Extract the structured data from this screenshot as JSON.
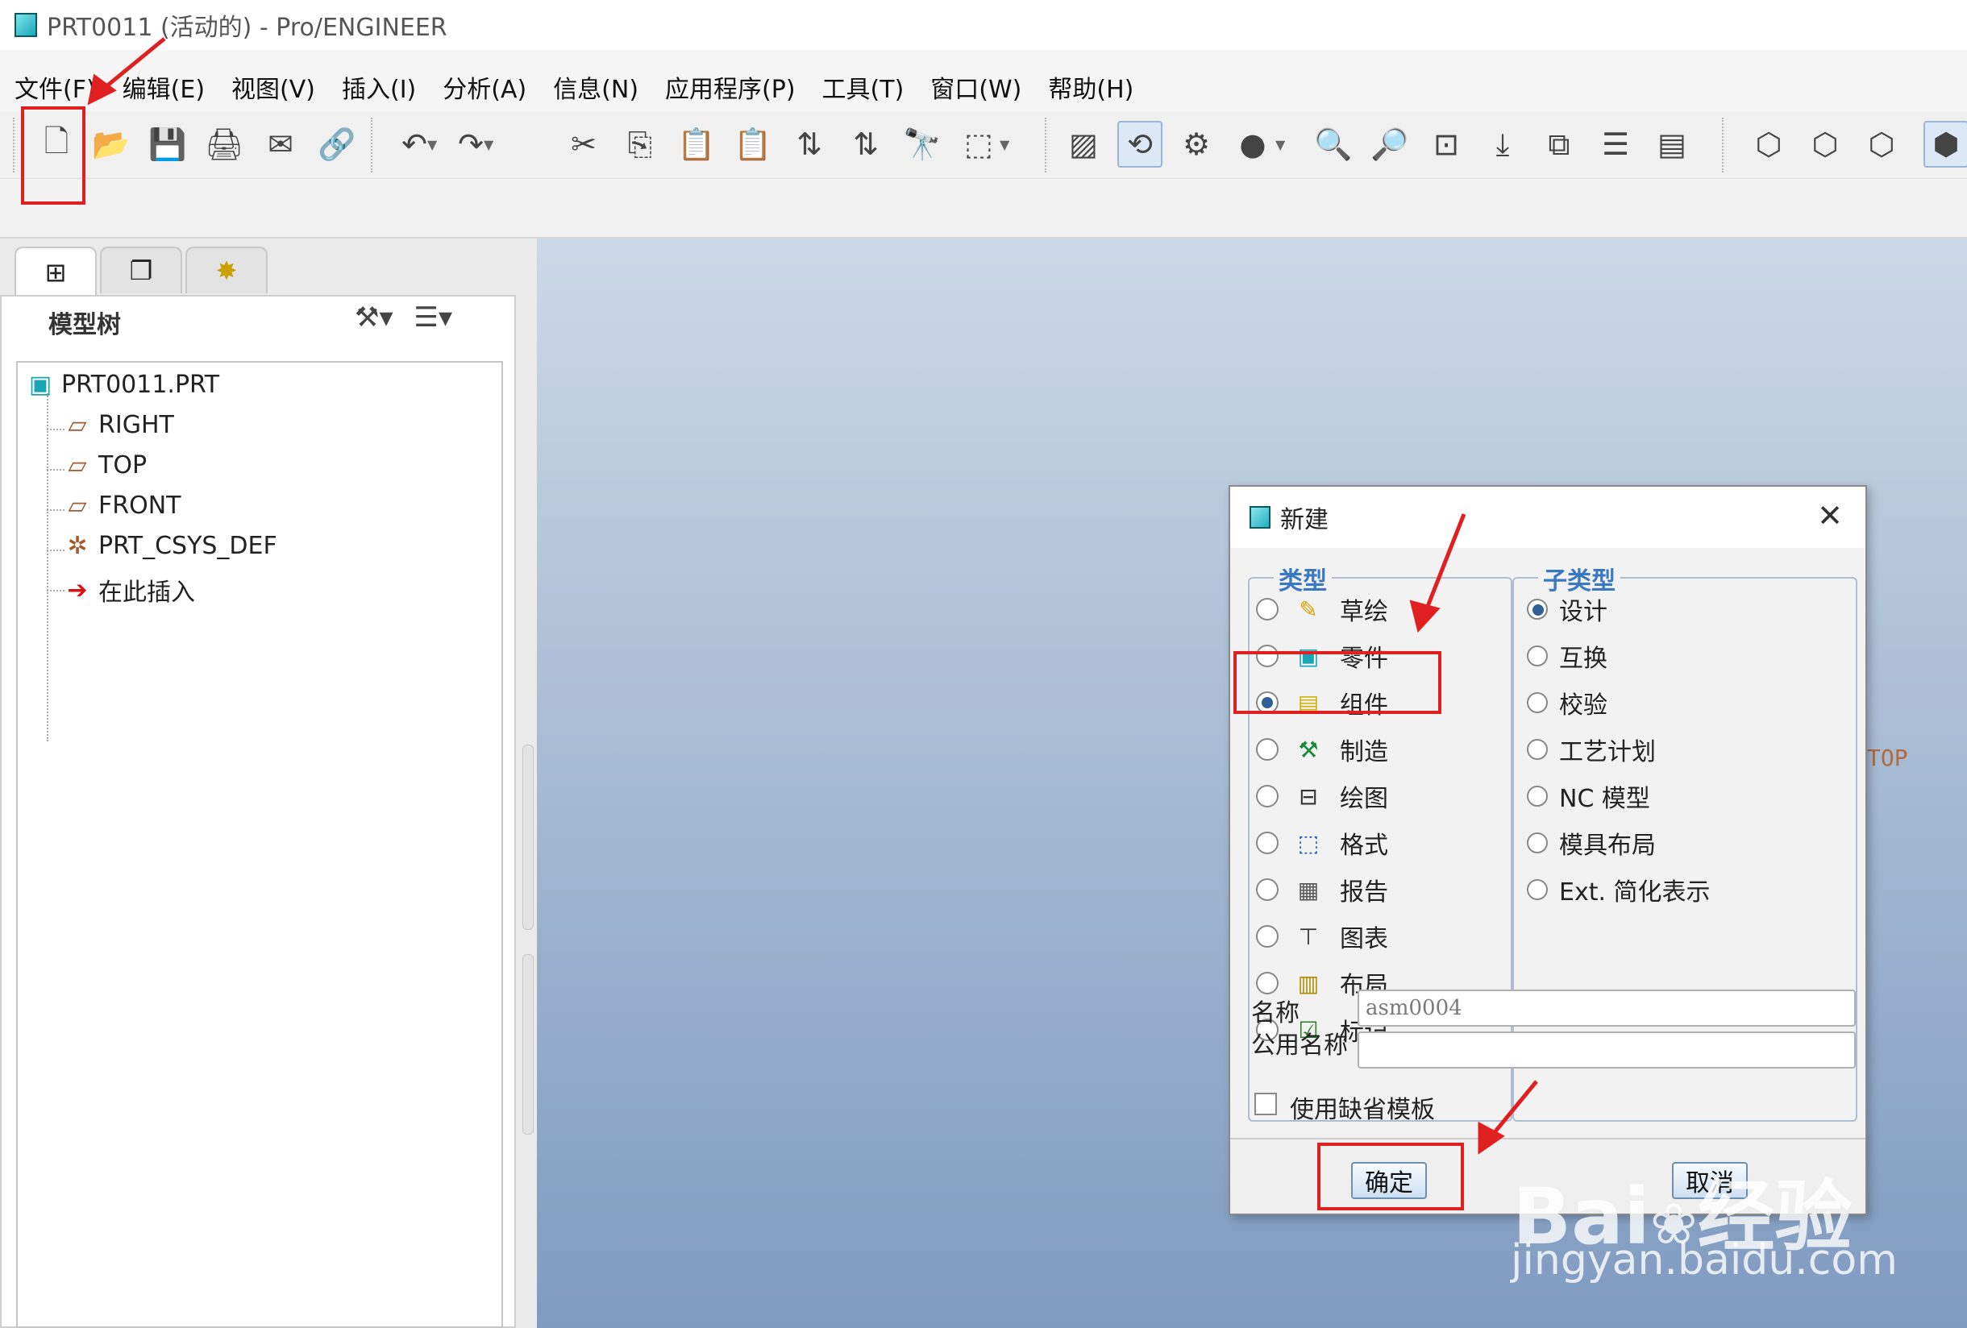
{
  "window": {
    "title": "PRT0011 (活动的) - Pro/ENGINEER"
  },
  "menu": [
    "文件(F)",
    "编辑(E)",
    "视图(V)",
    "插入(I)",
    "分析(A)",
    "信息(N)",
    "应用程序(P)",
    "工具(T)",
    "窗口(W)",
    "帮助(H)"
  ],
  "toolbar": {
    "buttons": [
      {
        "name": "new-icon",
        "glyph": "🗋"
      },
      {
        "name": "open-icon",
        "glyph": "📂"
      },
      {
        "name": "save-icon",
        "glyph": "💾"
      },
      {
        "name": "print-icon",
        "glyph": "🖨"
      },
      {
        "name": "send-mail-icon",
        "glyph": "✉"
      },
      {
        "name": "mail-link-icon",
        "glyph": "🔗"
      },
      {
        "name": "undo-icon",
        "glyph": "↶"
      },
      {
        "name": "redo-icon",
        "glyph": "↷"
      },
      {
        "name": "cut-icon",
        "glyph": "✂"
      },
      {
        "name": "copy-icon",
        "glyph": "⎘"
      },
      {
        "name": "paste-icon",
        "glyph": "📋"
      },
      {
        "name": "paste-special-icon",
        "glyph": "📋"
      },
      {
        "name": "regenerate-icon",
        "glyph": "⇅"
      },
      {
        "name": "regenerate-manager-icon",
        "glyph": "⇅"
      },
      {
        "name": "find-icon",
        "glyph": "🔭"
      },
      {
        "name": "select-box-icon",
        "glyph": "⬚"
      },
      {
        "name": "repaint-icon",
        "glyph": "▨"
      },
      {
        "name": "spin-center-icon",
        "glyph": "⟲"
      },
      {
        "name": "orient-mode-icon",
        "glyph": "⚙"
      },
      {
        "name": "appearance-icon",
        "glyph": "●"
      },
      {
        "name": "zoom-in-icon",
        "glyph": "🔍"
      },
      {
        "name": "zoom-out-icon",
        "glyph": "🔎"
      },
      {
        "name": "refit-icon",
        "glyph": "⊡"
      },
      {
        "name": "reorient-icon",
        "glyph": "⤓"
      },
      {
        "name": "saved-views-icon",
        "glyph": "⧉"
      },
      {
        "name": "layers-icon",
        "glyph": "☰"
      },
      {
        "name": "view-manager-icon",
        "glyph": "▤"
      },
      {
        "name": "wireframe-icon",
        "glyph": "⬡"
      },
      {
        "name": "hidden-line-icon",
        "glyph": "⬡"
      },
      {
        "name": "no-hidden-icon",
        "glyph": "⬡"
      },
      {
        "name": "shading-icon",
        "glyph": "⬢"
      }
    ]
  },
  "left_panel": {
    "tabs": [
      "model-tree-tab",
      "layer-tab",
      "folder-tab"
    ],
    "title": "模型树",
    "tree": [
      {
        "label": "PRT0011.PRT",
        "icon": "part-icon",
        "glyph": "▣"
      },
      {
        "label": "RIGHT",
        "icon": "datum-plane-icon",
        "glyph": "▱"
      },
      {
        "label": "TOP",
        "icon": "datum-plane-icon",
        "glyph": "▱"
      },
      {
        "label": "FRONT",
        "icon": "datum-plane-icon",
        "glyph": "▱"
      },
      {
        "label": "PRT_CSYS_DEF",
        "icon": "csys-icon",
        "glyph": "✲"
      },
      {
        "label": "在此插入",
        "icon": "insert-here-icon",
        "glyph": "➔"
      }
    ]
  },
  "graphics": {
    "datum_label": "TOP"
  },
  "dialog": {
    "title": "新建",
    "type_group": "类型",
    "subtype_group": "子类型",
    "types": [
      {
        "label": "草绘",
        "icon": "sketch-icon",
        "glyph": "✎",
        "selected": false
      },
      {
        "label": "零件",
        "icon": "part-icon",
        "glyph": "▣",
        "selected": false
      },
      {
        "label": "组件",
        "icon": "assembly-icon",
        "glyph": "▤",
        "selected": true
      },
      {
        "label": "制造",
        "icon": "manufacturing-icon",
        "glyph": "⚒",
        "selected": false
      },
      {
        "label": "绘图",
        "icon": "drawing-icon",
        "glyph": "⊟",
        "selected": false
      },
      {
        "label": "格式",
        "icon": "format-icon",
        "glyph": "⬚",
        "selected": false
      },
      {
        "label": "报告",
        "icon": "report-icon",
        "glyph": "▦",
        "selected": false
      },
      {
        "label": "图表",
        "icon": "diagram-icon",
        "glyph": "⊤",
        "selected": false
      },
      {
        "label": "布局",
        "icon": "layout-icon",
        "glyph": "▥",
        "selected": false
      },
      {
        "label": "标记",
        "icon": "markup-icon",
        "glyph": "☑",
        "selected": false
      }
    ],
    "subtypes": [
      {
        "label": "设计",
        "selected": true
      },
      {
        "label": "互换",
        "selected": false
      },
      {
        "label": "校验",
        "selected": false
      },
      {
        "label": "工艺计划",
        "selected": false
      },
      {
        "label": "NC 模型",
        "selected": false
      },
      {
        "label": "模具布局",
        "selected": false
      },
      {
        "label": "Ext. 简化表示",
        "selected": false
      }
    ],
    "name_label": "名称",
    "name_value": "asm0004",
    "common_name_label": "公用名称",
    "common_name_value": "",
    "use_default_template": "使用缺省模板",
    "use_default_template_checked": false,
    "ok_label": "确定",
    "cancel_label": "取消"
  },
  "watermark": {
    "brand": "Bai",
    "brand2": "经验",
    "url": "jingyan.baidu.com"
  },
  "colors": {
    "annotation": "#e02020",
    "graphics_top": "#ccd8e6",
    "graphics_bottom": "#7f9bc0",
    "group_title": "#3b78c2"
  }
}
